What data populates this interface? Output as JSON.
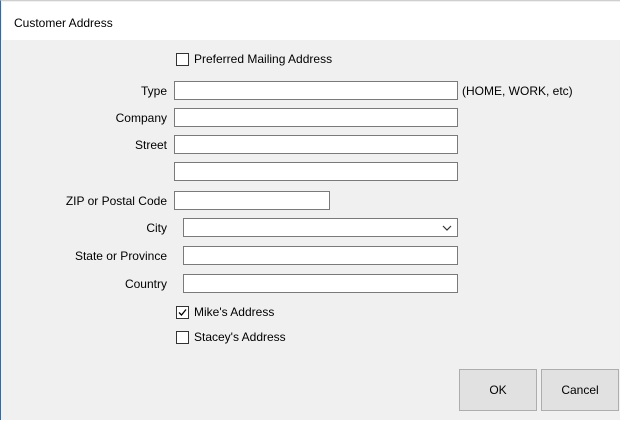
{
  "window": {
    "title": "Customer Address"
  },
  "preferred_mailing": {
    "label": "Preferred Mailing Address",
    "checked": false
  },
  "fields": {
    "type": {
      "label": "Type",
      "value": "",
      "hint": "(HOME, WORK, etc)"
    },
    "company": {
      "label": "Company",
      "value": ""
    },
    "street": {
      "label": "Street",
      "value": "",
      "value2": ""
    },
    "zip": {
      "label": "ZIP or Postal Code",
      "value": ""
    },
    "city": {
      "label": "City",
      "value": ""
    },
    "state": {
      "label": "State or Province",
      "value": ""
    },
    "country": {
      "label": "Country",
      "value": ""
    }
  },
  "associations": [
    {
      "label": "Mike's Address",
      "checked": true
    },
    {
      "label": "Stacey's Address",
      "checked": false
    }
  ],
  "buttons": {
    "ok": "OK",
    "cancel": "Cancel"
  },
  "icons": {
    "checkmark": "check-icon",
    "dropdown": "chevron-down-icon"
  }
}
